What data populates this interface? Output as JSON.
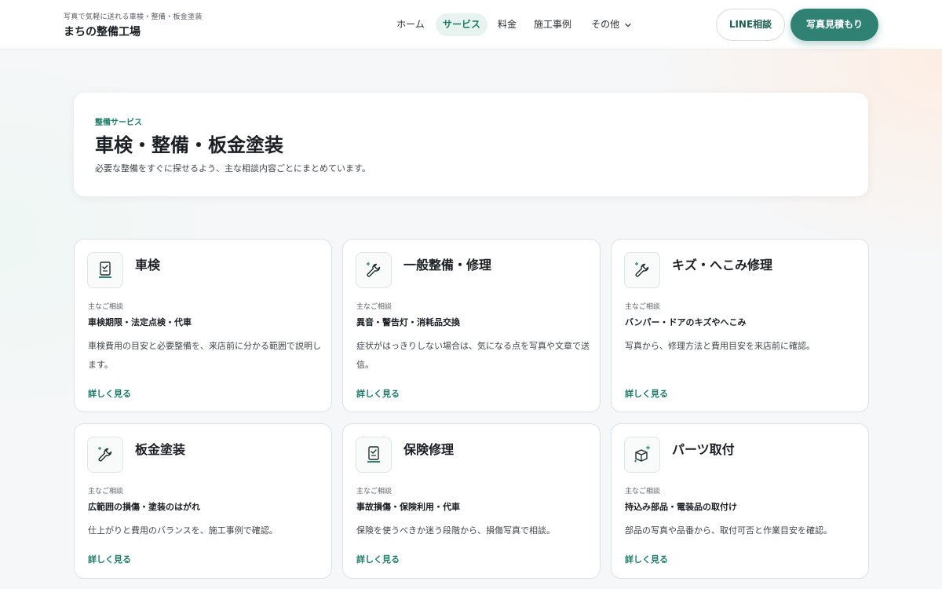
{
  "brand": {
    "tagline": "写真で気軽に送れる車検・整備・板金塗装",
    "name": "まちの整備工場"
  },
  "nav": {
    "items": [
      {
        "label": "ホーム",
        "active": false
      },
      {
        "label": "サービス",
        "active": true
      },
      {
        "label": "料金",
        "active": false
      },
      {
        "label": "施工事例",
        "active": false
      },
      {
        "label": "その他",
        "active": false,
        "has_dropdown": true
      }
    ],
    "line_button": "LINE相談",
    "photo_button": "写真見積もり"
  },
  "hero": {
    "kicker": "整備サービス",
    "title": "車検・整備・板金塗装",
    "description": "必要な整備をすぐに探せるよう、主な相談内容ごとにまとめています。"
  },
  "cards": [
    {
      "title": "車検",
      "icon": "document-check-icon",
      "label": "主なご相談",
      "topics": "車検期限・法定点検・代車",
      "description": "車検費用の目安と必要整備を、来店前に分かる範囲で説明します。",
      "link": "詳しく見る"
    },
    {
      "title": "一般整備・修理",
      "icon": "wrench-icon",
      "label": "主なご相談",
      "topics": "異音・警告灯・消耗品交換",
      "description": "症状がはっきりしない場合は、気になる点を写真や文章で送信。",
      "link": "詳しく見る"
    },
    {
      "title": "キズ・へこみ修理",
      "icon": "wrench-icon",
      "label": "主なご相談",
      "topics": "バンパー・ドアのキズやへこみ",
      "description": "写真から、修理方法と費用目安を来店前に確認。",
      "link": "詳しく見る"
    },
    {
      "title": "板金塗装",
      "icon": "wrench-icon",
      "label": "主なご相談",
      "topics": "広範囲の損傷・塗装のはがれ",
      "description": "仕上がりと費用のバランスを、施工事例で確認。",
      "link": "詳しく見る"
    },
    {
      "title": "保険修理",
      "icon": "document-check-icon",
      "label": "主なご相談",
      "topics": "事故損傷・保険利用・代車",
      "description": "保険を使うべきか迷う段階から、損傷写真で相談。",
      "link": "詳しく見る"
    },
    {
      "title": "パーツ取付",
      "icon": "box-plus-icon",
      "label": "主なご相談",
      "topics": "持込み部品・電装品の取付け",
      "description": "部品の写真や品番から、取付可否と作業目安を確認。",
      "link": "詳しく見る"
    }
  ],
  "colors": {
    "accent": "#2f8273",
    "accent_text": "#1d7a68",
    "active_nav_bg": "#e7f3ef"
  }
}
